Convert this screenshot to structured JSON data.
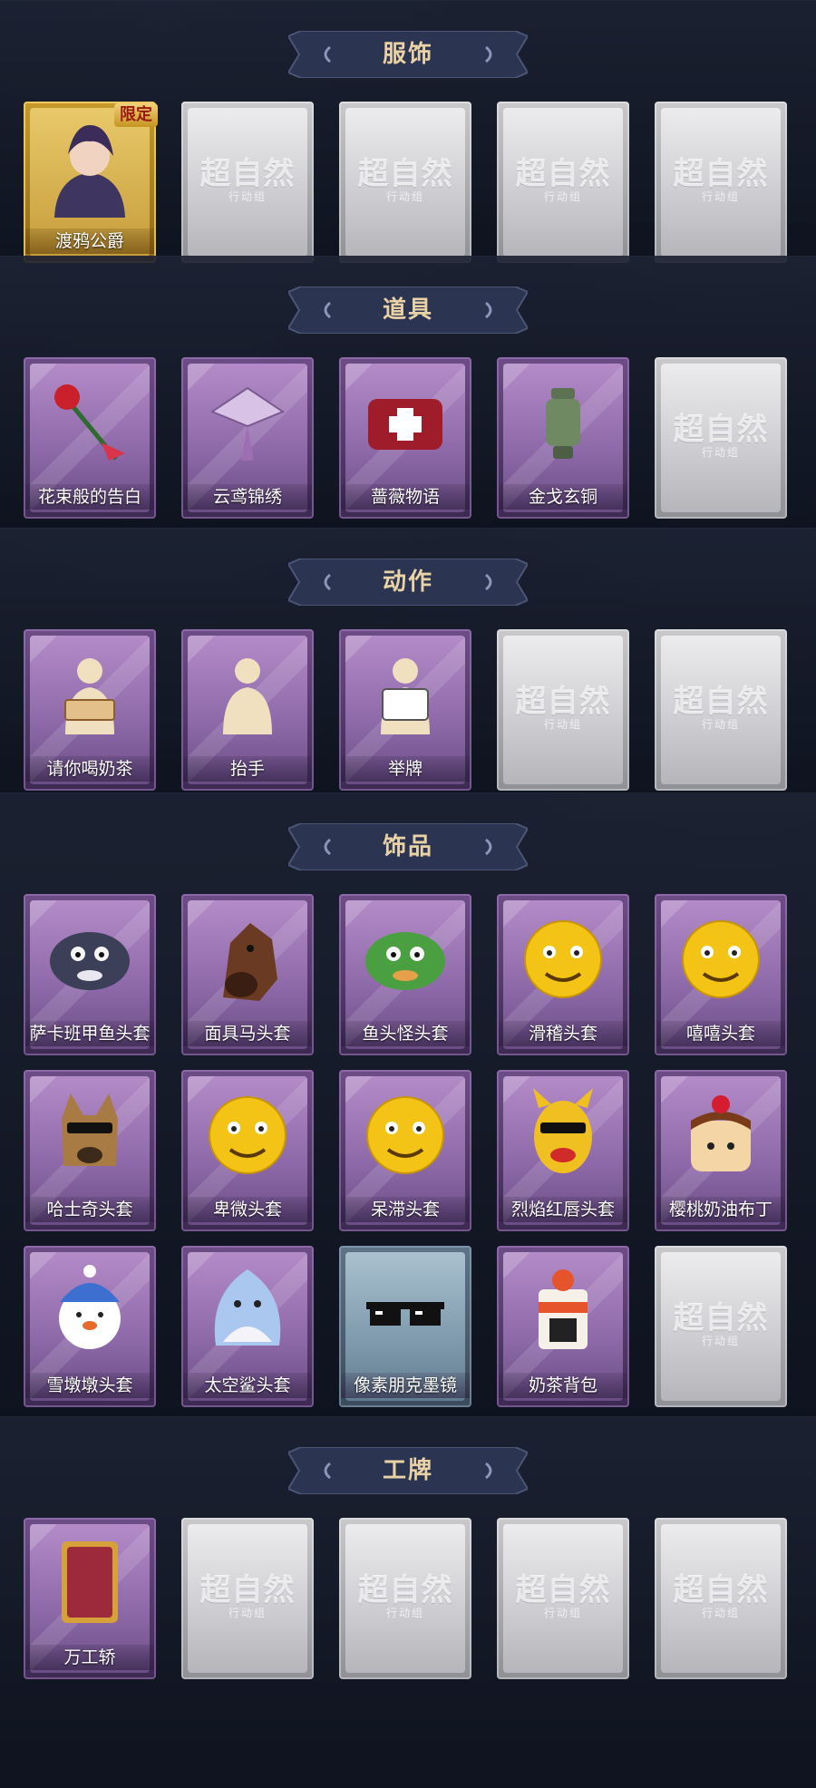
{
  "sections": [
    {
      "title": "服饰",
      "items": [
        {
          "label": "渡鸦公爵",
          "style": "gold",
          "icon": "raven-duke-portrait",
          "tag": "限定"
        },
        {
          "label": "",
          "style": "empty",
          "icon": "empty-slot-logo"
        },
        {
          "label": "",
          "style": "empty",
          "icon": "empty-slot-logo"
        },
        {
          "label": "",
          "style": "empty",
          "icon": "empty-slot-logo"
        },
        {
          "label": "",
          "style": "empty",
          "icon": "empty-slot-logo"
        }
      ]
    },
    {
      "title": "道具",
      "items": [
        {
          "label": "花束般的告白",
          "style": "purple",
          "icon": "rose-bouquet-icon"
        },
        {
          "label": "云鸢锦绣",
          "style": "purple",
          "icon": "embroidered-kite-icon"
        },
        {
          "label": "蔷薇物语",
          "style": "purple",
          "icon": "first-aid-bag-icon"
        },
        {
          "label": "金戈玄铜",
          "style": "purple",
          "icon": "bronze-lantern-icon"
        },
        {
          "label": "",
          "style": "empty",
          "icon": "empty-slot-logo"
        }
      ]
    },
    {
      "title": "动作",
      "items": [
        {
          "label": "请你喝奶茶",
          "style": "purple",
          "icon": "serve-tea-action-icon"
        },
        {
          "label": "抬手",
          "style": "purple",
          "icon": "raise-hand-action-icon"
        },
        {
          "label": "举牌",
          "style": "purple",
          "icon": "hold-sign-action-icon"
        },
        {
          "label": "",
          "style": "empty",
          "icon": "empty-slot-logo"
        },
        {
          "label": "",
          "style": "empty",
          "icon": "empty-slot-logo"
        }
      ]
    },
    {
      "title": "饰品",
      "items": [
        {
          "label": "萨卡班甲鱼头套",
          "style": "purple",
          "icon": "fish-head-mask-icon"
        },
        {
          "label": "面具马头套",
          "style": "purple",
          "icon": "horse-head-mask-icon"
        },
        {
          "label": "鱼头怪头套",
          "style": "purple",
          "icon": "green-fish-head-icon"
        },
        {
          "label": "滑稽头套",
          "style": "purple",
          "icon": "funny-face-icon"
        },
        {
          "label": "嘻嘻头套",
          "style": "purple",
          "icon": "grin-face-icon"
        },
        {
          "label": "哈士奇头套",
          "style": "purple",
          "icon": "husky-head-icon"
        },
        {
          "label": "卑微头套",
          "style": "purple",
          "icon": "humble-face-icon"
        },
        {
          "label": "呆滞头套",
          "style": "purple",
          "icon": "dazed-face-icon"
        },
        {
          "label": "烈焰红唇头套",
          "style": "purple",
          "icon": "red-lips-head-icon"
        },
        {
          "label": "樱桃奶油布丁",
          "style": "purple",
          "icon": "cherry-pudding-icon"
        },
        {
          "label": "雪墩墩头套",
          "style": "purple",
          "icon": "snowman-head-icon"
        },
        {
          "label": "太空鲨头套",
          "style": "purple",
          "icon": "space-shark-head-icon"
        },
        {
          "label": "像素朋克墨镜",
          "style": "blue",
          "icon": "pixel-sunglasses-icon"
        },
        {
          "label": "奶茶背包",
          "style": "purple",
          "icon": "milk-tea-backpack-icon"
        },
        {
          "label": "",
          "style": "empty",
          "icon": "empty-slot-logo"
        }
      ]
    },
    {
      "title": "工牌",
      "items": [
        {
          "label": "万工轿",
          "style": "purple",
          "icon": "badge-frame-icon"
        },
        {
          "label": "",
          "style": "empty",
          "icon": "empty-slot-logo"
        },
        {
          "label": "",
          "style": "empty",
          "icon": "empty-slot-logo"
        },
        {
          "label": "",
          "style": "empty",
          "icon": "empty-slot-logo"
        },
        {
          "label": "",
          "style": "empty",
          "icon": "empty-slot-logo"
        }
      ]
    }
  ],
  "empty_slot": {
    "logo": "超自然",
    "sub": "行动组"
  },
  "colors": {
    "background": "#0f1522",
    "banner": "#2b3450",
    "banner_text": "#e9d3a6",
    "purple_card": "#8d68a8",
    "gold_card": "#c79a2a",
    "blue_card": "#7f9aad",
    "empty_card": "#cfcfd3"
  }
}
